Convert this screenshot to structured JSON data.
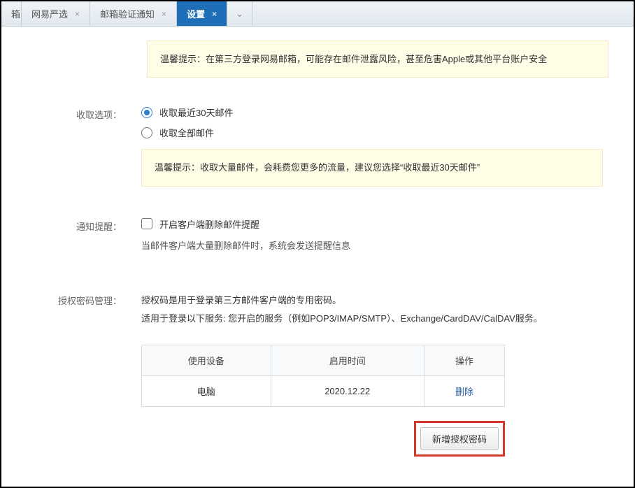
{
  "tabs": {
    "t0_label": "箱",
    "t1_label": "网易严选",
    "t2_label": "邮箱验证通知",
    "t3_label": "设置",
    "close_glyph": "×",
    "dropdown_glyph": "⌄"
  },
  "tip1": "温馨提示：在第三方登录网易邮箱，可能存在邮件泄露风险，甚至危害Apple或其他平台账户安全",
  "receive": {
    "label": "收取选项：",
    "opt1": "收取最近30天邮件",
    "opt2": "收取全部邮件",
    "tip": "温馨提示：收取大量邮件，会耗费您更多的流量，建议您选择“收取最近30天邮件”"
  },
  "notify": {
    "label": "通知提醒：",
    "check_label": "开启客户端删除邮件提醒",
    "hint": "当邮件客户端大量删除邮件时，系统会发送提醒信息"
  },
  "auth": {
    "label": "授权密码管理：",
    "desc1": "授权码是用于登录第三方邮件客户端的专用密码。",
    "desc2": "适用于登录以下服务: 您开启的服务（例如POP3/IMAP/SMTP）、Exchange/CardDAV/CalDAV服务。",
    "th1": "使用设备",
    "th2": "启用时间",
    "th3": "操作",
    "td1": "电脑",
    "td2": "2020.12.22",
    "td3": "删除",
    "btn": "新增授权密码"
  }
}
